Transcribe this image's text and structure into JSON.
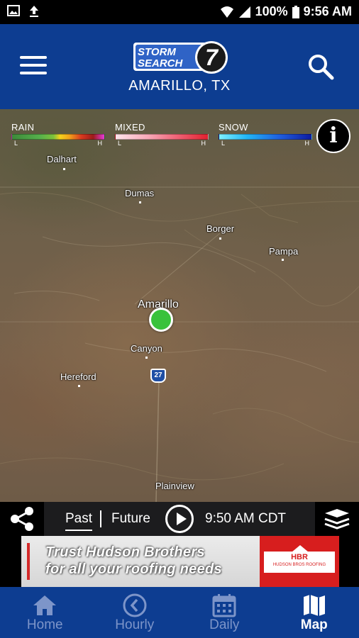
{
  "status_bar": {
    "battery": "100%",
    "time": "9:56 AM"
  },
  "header": {
    "logo_line1": "STORM",
    "logo_line2": "SEARCH",
    "logo_number": "7",
    "location": "AMARILLO, TX"
  },
  "legend": {
    "rain": {
      "title": "RAIN",
      "low": "L",
      "high": "H"
    },
    "mixed": {
      "title": "MIXED",
      "low": "L",
      "high": "H"
    },
    "snow": {
      "title": "SNOW",
      "low": "L",
      "high": "H"
    },
    "info_label": "i"
  },
  "map": {
    "cities": {
      "dalhart": "Dalhart",
      "dumas": "Dumas",
      "borger": "Borger",
      "pampa": "Pampa",
      "amarillo": "Amarillo",
      "canyon": "Canyon",
      "hereford": "Hereford",
      "plainview": "Plainview"
    },
    "highway": "27"
  },
  "controls": {
    "past": "Past",
    "future": "Future",
    "time": "9:50 AM CDT"
  },
  "ad": {
    "line1": "Trust Hudson Brothers",
    "line2": "for all your roofing needs",
    "logo_text": "HBR",
    "logo_sub": "HUDSON BROS ROOFING"
  },
  "nav": {
    "home": "Home",
    "hourly": "Hourly",
    "daily": "Daily",
    "map": "Map"
  },
  "colors": {
    "brand_blue": "#0d3d91",
    "location_marker": "#39c23b",
    "nav_inactive": "#7d95c9"
  }
}
